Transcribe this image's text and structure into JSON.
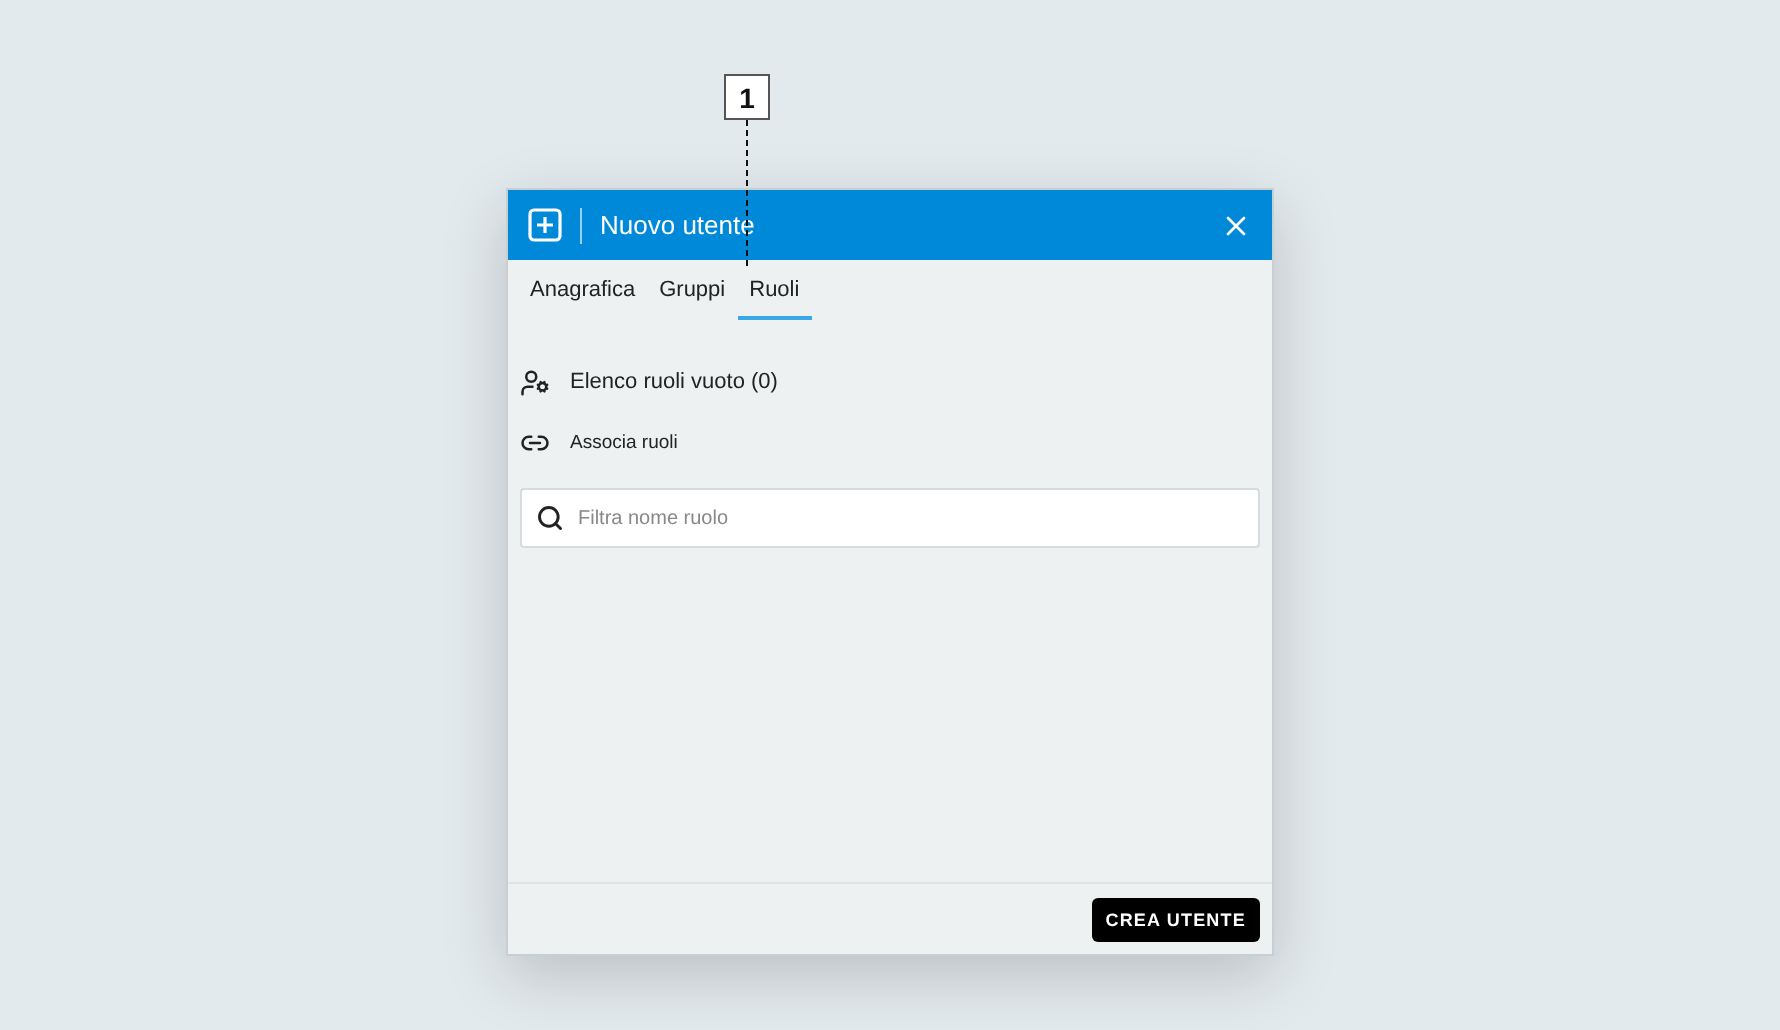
{
  "callout": {
    "label": "1"
  },
  "window": {
    "title": "Nuovo utente"
  },
  "tabs": [
    {
      "label": "Anagrafica",
      "selected": false
    },
    {
      "label": "Gruppi",
      "selected": false
    },
    {
      "label": "Ruoli",
      "selected": true
    }
  ],
  "roles_list": {
    "label": "Elenco ruoli vuoto (0)"
  },
  "associate": {
    "label": "Associa ruoli"
  },
  "search": {
    "placeholder": "Filtra nome ruolo"
  },
  "buttons": [
    "CREA UTENTE"
  ]
}
